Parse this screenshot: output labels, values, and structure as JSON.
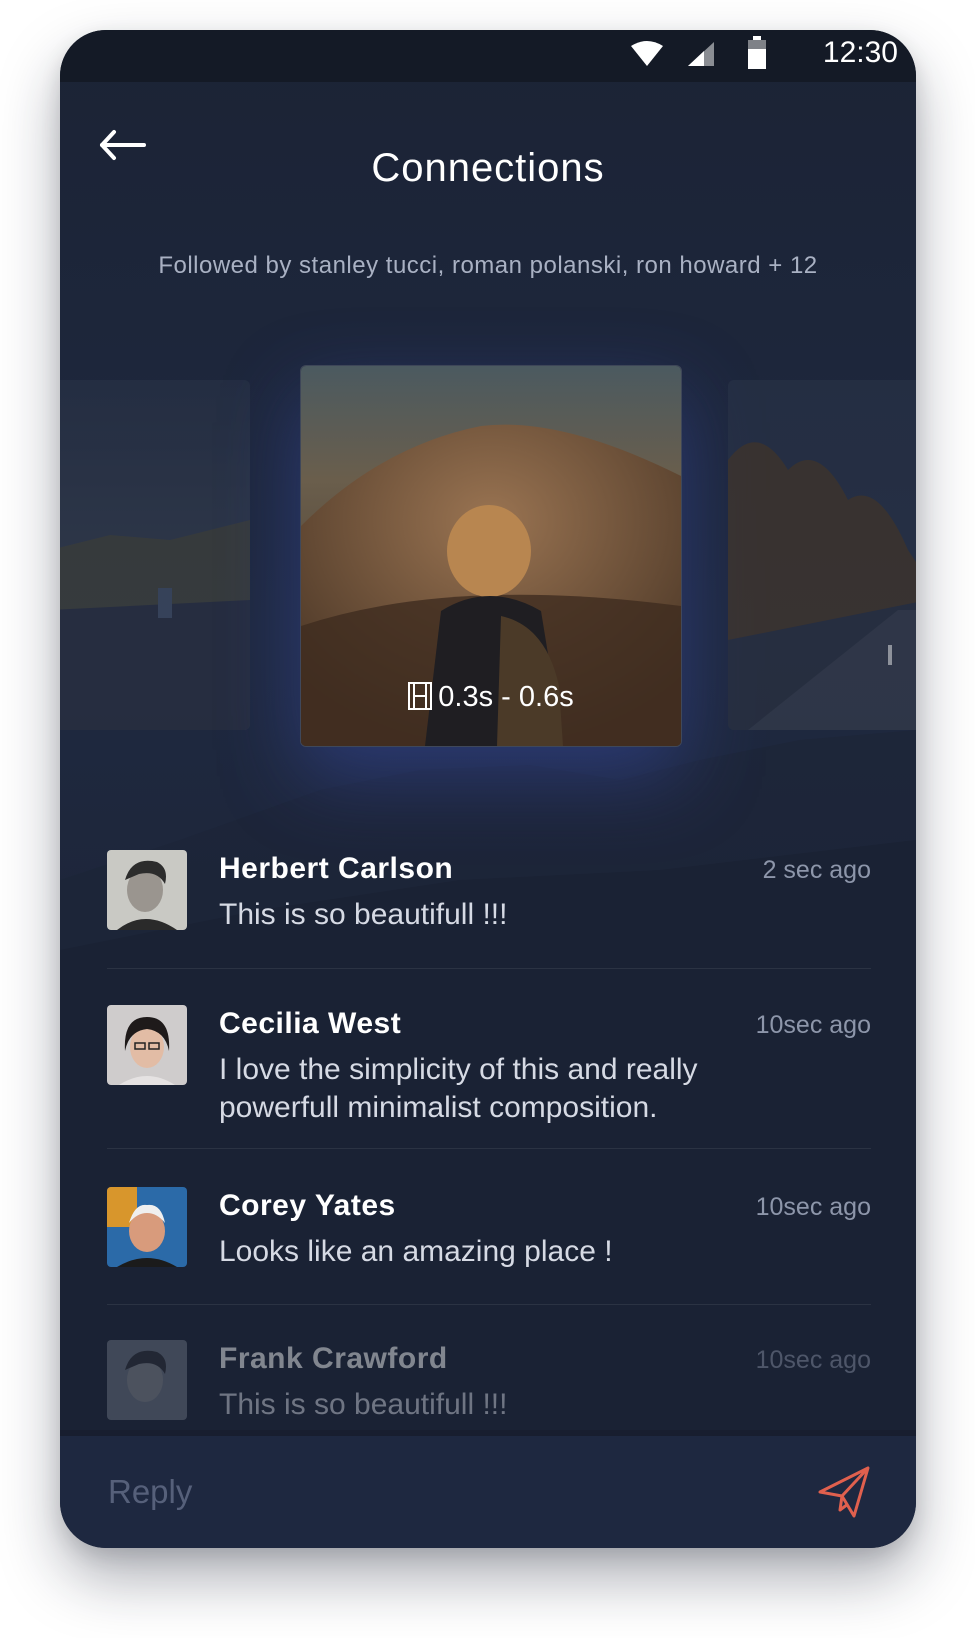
{
  "statusbar": {
    "time": "12:30",
    "icons": [
      "wifi-icon",
      "signal-icon",
      "battery-icon"
    ]
  },
  "header": {
    "title": "Connections",
    "back_icon": "arrow-left-icon"
  },
  "followed_text": "Followed by stanley tucci, roman polanski, ron howard + 12",
  "carousel": {
    "duration_label": "0.3s - 0.6s",
    "duration_icon": "film-icon"
  },
  "comments": [
    {
      "name": "Herbert Carlson",
      "time": "2 sec ago",
      "text": "This is so beautifull !!!"
    },
    {
      "name": "Cecilia West",
      "time": "10sec ago",
      "text": "I love the simplicity of this and really powerfull minimalist composition."
    },
    {
      "name": "Corey Yates",
      "time": "10sec ago",
      "text": "Looks like an amazing place !"
    },
    {
      "name": "Frank Crawford",
      "time": "10sec ago",
      "text": "This is so beautifull !!!"
    }
  ],
  "reply": {
    "placeholder": "Reply",
    "send_icon": "paper-plane-icon"
  },
  "colors": {
    "accent": "#e0604e",
    "background": "#1f2940",
    "reply_bar": "#1e2840"
  }
}
